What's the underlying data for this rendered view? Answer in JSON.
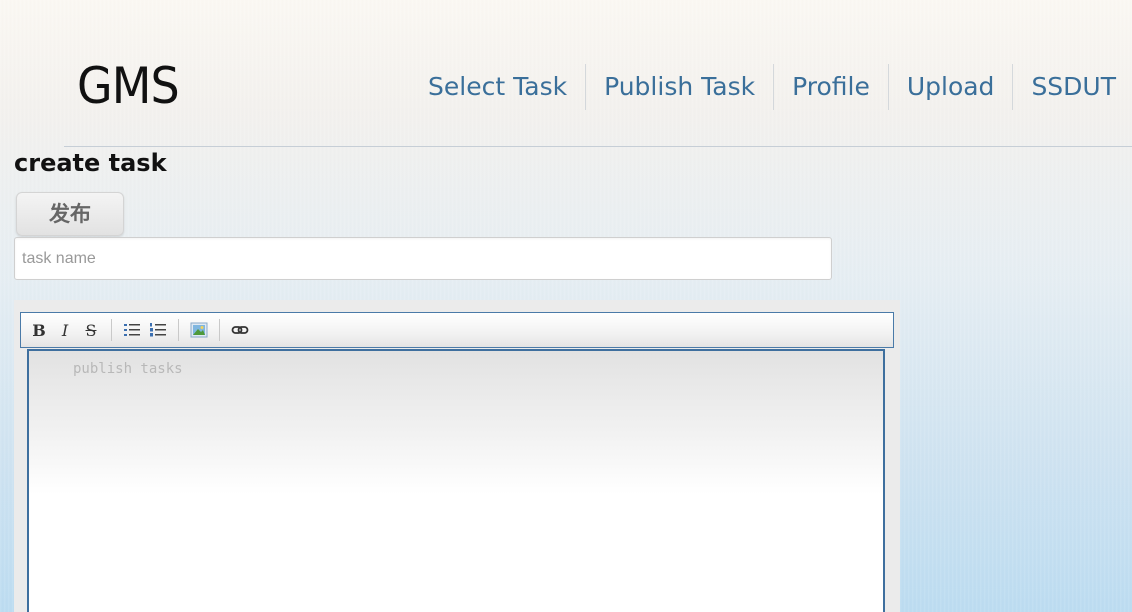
{
  "header": {
    "brand": "GMS",
    "nav": [
      {
        "label": "Select Task"
      },
      {
        "label": "Publish Task"
      },
      {
        "label": "Profile"
      },
      {
        "label": "Upload"
      },
      {
        "label": "SSDUT"
      }
    ]
  },
  "main": {
    "title": "create task",
    "publish_button": "发布",
    "task_name": {
      "value": "",
      "placeholder": "task name"
    },
    "editor": {
      "placeholder": "publish tasks",
      "toolbar": [
        {
          "icon": "bold-icon",
          "label": "B"
        },
        {
          "icon": "italic-icon",
          "label": "I"
        },
        {
          "icon": "strikethrough-icon",
          "label": "S"
        },
        {
          "icon": "bulleted-list-icon"
        },
        {
          "icon": "numbered-list-icon"
        },
        {
          "icon": "insert-image-icon"
        },
        {
          "icon": "insert-link-icon"
        }
      ]
    }
  },
  "colors": {
    "nav_link": "#3a6f9a",
    "editor_border": "#3e6f9e"
  }
}
